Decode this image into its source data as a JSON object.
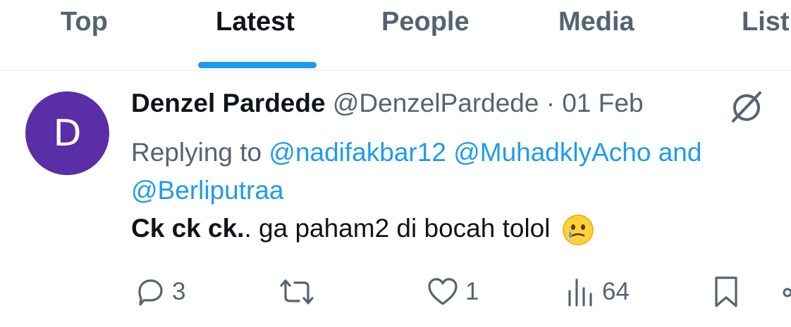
{
  "tabs": [
    {
      "label": "Top"
    },
    {
      "label": "Latest"
    },
    {
      "label": "People"
    },
    {
      "label": "Media"
    },
    {
      "label": "List"
    }
  ],
  "active_tab": "Latest",
  "tweet": {
    "avatar_initial": "D",
    "display_name": "Denzel Pardede",
    "handle": "@DenzelPardede",
    "separator": "·",
    "date": "01 Feb",
    "replying_prefix": "Replying to",
    "mentions": [
      "@nadifakbar12",
      "@MuhadklyAcho",
      "@Berliputraa"
    ],
    "mentions_joiner": "and",
    "text_bold": "Ck ck ck.",
    "text_rest": ". ga paham2 di bocah tolol",
    "emoji": "face-holding-back-tears",
    "reply_count": "3",
    "like_count": "1",
    "views_count": "64"
  },
  "icons": {
    "more": "grok-icon",
    "reply": "reply-icon",
    "retweet": "retweet-icon",
    "like": "heart-icon",
    "views": "views-icon",
    "bookmark": "bookmark-icon",
    "share": "share-icon"
  },
  "colors": {
    "accent": "#1d9bf0",
    "secondary_text": "#536471",
    "primary_text": "#0f1419",
    "avatar_bg": "#5a2ea6"
  }
}
